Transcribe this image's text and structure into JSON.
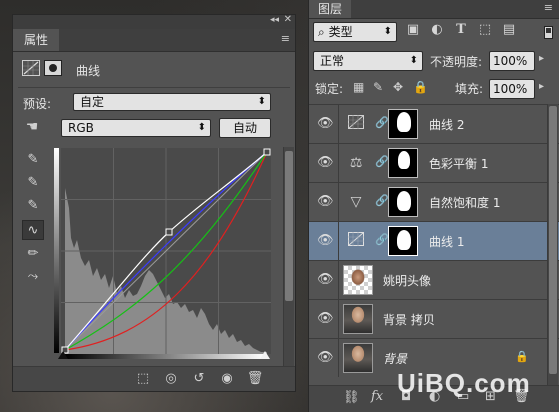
{
  "properties_panel": {
    "tab_label": "属性",
    "collapse_glyph": "◂◂",
    "close_glyph": "✕",
    "menu_glyph": "≡",
    "header_title": "曲线",
    "preset_label": "预设:",
    "preset_value": "自定",
    "channel_value": "RGB",
    "auto_label": "自动",
    "tool_icons": [
      "sample-black-point-icon",
      "sample-gray-point-icon",
      "sample-white-point-icon",
      "curve-point-tool-icon",
      "pencil-draw-icon",
      "smooth-curve-icon"
    ],
    "footer_icons": [
      "clip-to-layer-icon",
      "view-previous-state-icon",
      "reset-icon",
      "visibility-eye-icon",
      "delete-trash-icon"
    ]
  },
  "layers_panel": {
    "tab_label": "图层",
    "menu_glyph": "≡",
    "kind_filter_value": "类型",
    "blend_mode": "正常",
    "opacity_label": "不透明度:",
    "opacity_value": "100%",
    "lock_label": "锁定:",
    "fill_label": "填充:",
    "fill_value": "100%",
    "layers": [
      {
        "name": "曲线 2",
        "kind": "curves-adjustment",
        "selected": false
      },
      {
        "name": "色彩平衡 1",
        "kind": "color-balance-adjustment",
        "selected": false
      },
      {
        "name": "自然饱和度 1",
        "kind": "vibrance-adjustment",
        "selected": false
      },
      {
        "name": "曲线 1",
        "kind": "curves-adjustment",
        "selected": true
      },
      {
        "name": "姚明头像",
        "kind": "pixel-layer",
        "selected": false
      },
      {
        "name": "背景 拷贝",
        "kind": "pixel-layer",
        "selected": false
      },
      {
        "name": "背景",
        "kind": "background-layer",
        "selected": false,
        "locked": true
      }
    ]
  },
  "watermark": "UiBQ.com",
  "colors": {
    "panel_bg": "#535353",
    "selected_row": "#6a7f98",
    "curve_rgb": "#ffffff",
    "curve_blue": "#3b3bff",
    "curve_green": "#16c016",
    "curve_red": "#e02020"
  }
}
